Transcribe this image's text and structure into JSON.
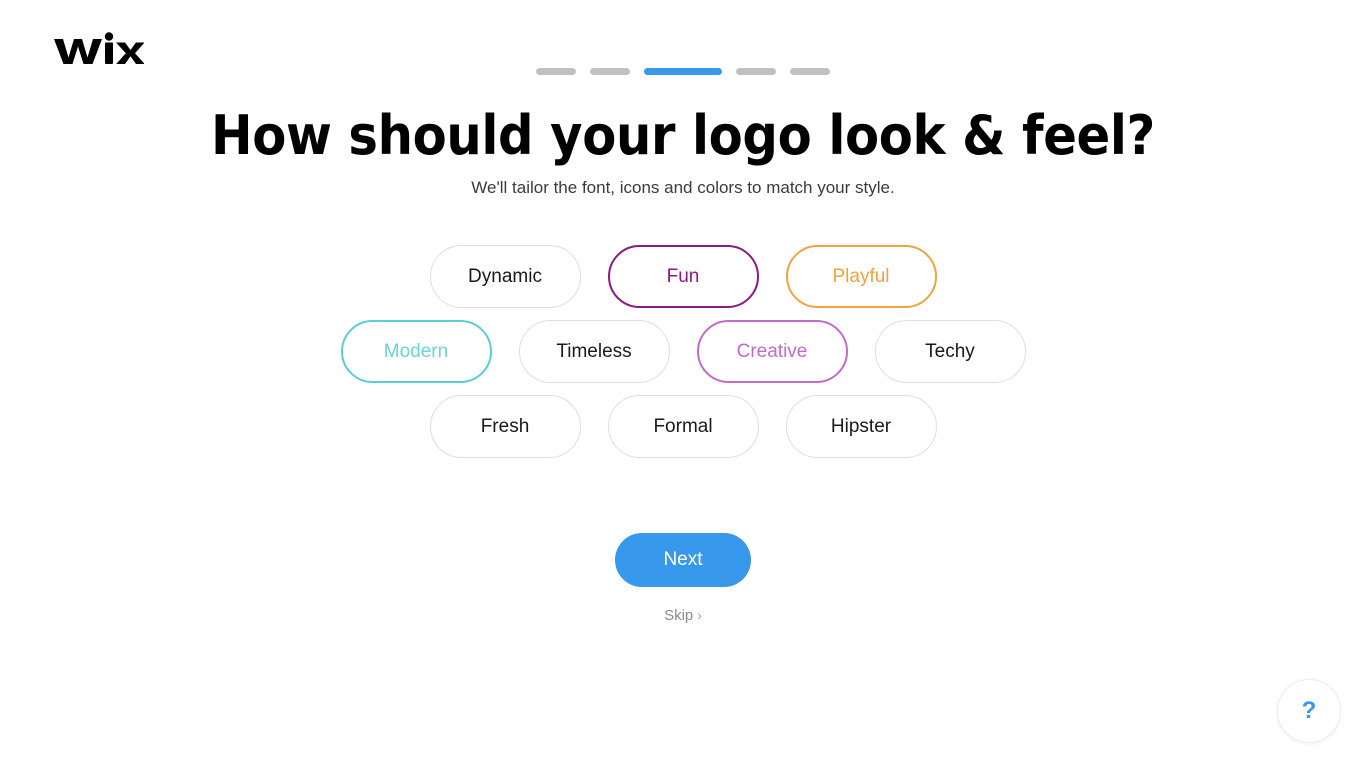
{
  "brand": {
    "logo_text": "WiX",
    "logo_icon": "wix-logo"
  },
  "progress": {
    "total_steps": 5,
    "current_step": 3,
    "active_color": "#3899ec",
    "inactive_color": "#c1c1c1",
    "steps": [
      {
        "index": 1,
        "active": false
      },
      {
        "index": 2,
        "active": false
      },
      {
        "index": 3,
        "active": true
      },
      {
        "index": 4,
        "active": false
      },
      {
        "index": 5,
        "active": false
      }
    ]
  },
  "header": {
    "title": "How should your logo look & feel?",
    "subtitle": "We'll tailor the font, icons and colors to match your style."
  },
  "chips": {
    "rows": [
      [
        {
          "label": "Dynamic",
          "selected": false,
          "color": "#17191c"
        },
        {
          "label": "Fun",
          "selected": true,
          "color": "#8b1a82"
        },
        {
          "label": "Playful",
          "selected": true,
          "color": "#f2a341"
        }
      ],
      [
        {
          "label": "Modern",
          "selected": true,
          "color": "#5bcfcf"
        },
        {
          "label": "Timeless",
          "selected": false,
          "color": "#17191c"
        },
        {
          "label": "Creative",
          "selected": true,
          "color": "#c26bc8"
        },
        {
          "label": "Techy",
          "selected": false,
          "color": "#17191c"
        }
      ],
      [
        {
          "label": "Fresh",
          "selected": false,
          "color": "#17191c"
        },
        {
          "label": "Formal",
          "selected": false,
          "color": "#17191c"
        },
        {
          "label": "Hipster",
          "selected": false,
          "color": "#17191c"
        }
      ]
    ]
  },
  "actions": {
    "next_label": "Next",
    "next_color": "#3899ec",
    "skip_label": "Skip",
    "skip_chevron": "›"
  },
  "help": {
    "glyph": "?",
    "icon": "question-mark-icon",
    "color": "#3899ec"
  }
}
